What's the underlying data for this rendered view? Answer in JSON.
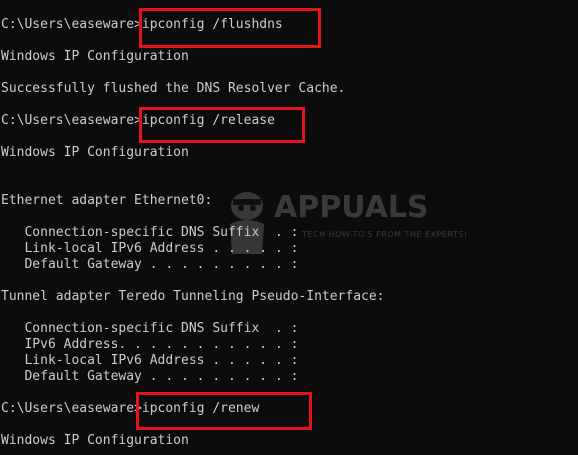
{
  "terminal": {
    "lines": [
      "C:\\Users\\easeware>ipconfig /flushdns",
      "",
      "Windows IP Configuration",
      "",
      "Successfully flushed the DNS Resolver Cache.",
      "",
      "C:\\Users\\easeware>ipconfig /release",
      "",
      "Windows IP Configuration",
      "",
      "",
      "Ethernet adapter Ethernet0:",
      "",
      "   Connection-specific DNS Suffix  . :",
      "   Link-local IPv6 Address . . . . . :",
      "   Default Gateway . . . . . . . . . :",
      "",
      "Tunnel adapter Teredo Tunneling Pseudo-Interface:",
      "",
      "   Connection-specific DNS Suffix  . :",
      "   IPv6 Address. . . . . . . . . . . :",
      "   Link-local IPv6 Address . . . . . :",
      "   Default Gateway . . . . . . . . . :",
      "",
      "C:\\Users\\easeware>ipconfig /renew",
      "",
      "Windows IP Configuration"
    ]
  },
  "watermark": {
    "brand": "APPUALS",
    "tagline": "TECH HOW-TO'S FROM THE EXPERTS!"
  },
  "colors": {
    "background": "#0c0c0c",
    "text": "#cccccc",
    "highlight": "#e3131b"
  }
}
